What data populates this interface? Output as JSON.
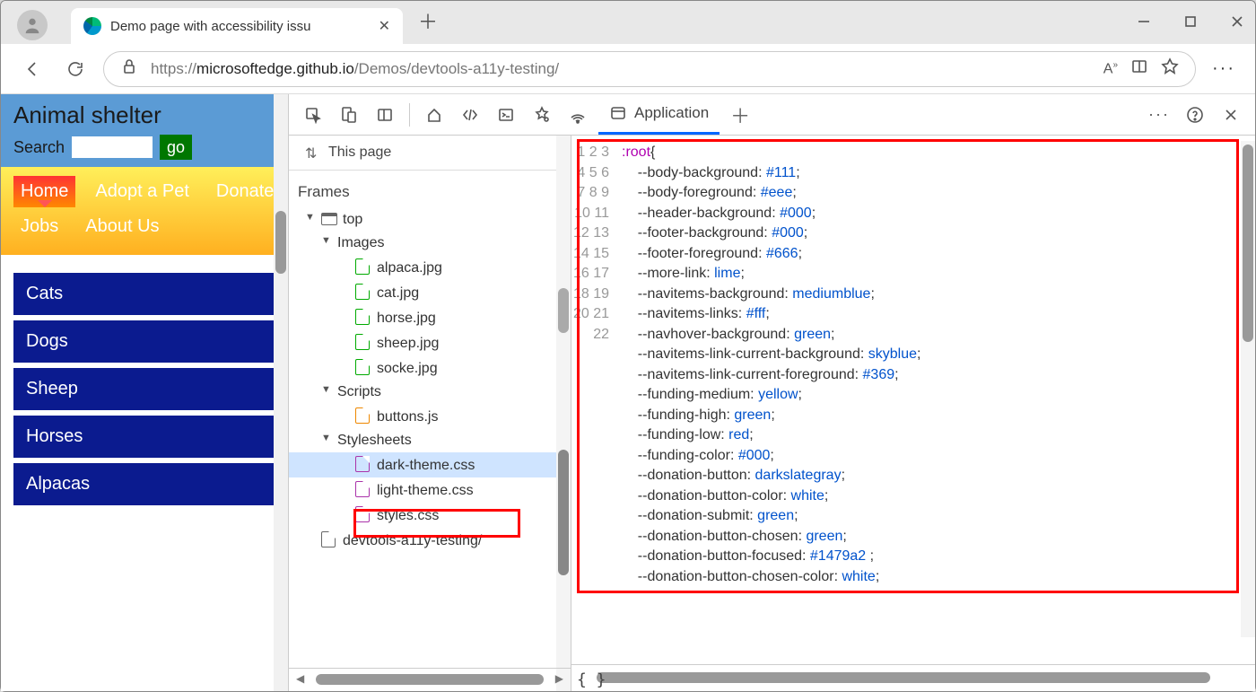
{
  "tab": {
    "title": "Demo page with accessibility issu"
  },
  "url": {
    "scheme": "https://",
    "host": "microsoftedge.github.io",
    "path": "/Demos/devtools-a11y-testing/"
  },
  "page": {
    "title": "Animal shelter",
    "searchLabel": "Search",
    "goLabel": "go",
    "nav": [
      "Home",
      "Adopt a Pet",
      "Donate",
      "Jobs",
      "About Us"
    ],
    "cats": [
      "Cats",
      "Dogs",
      "Sheep",
      "Horses",
      "Alpacas"
    ]
  },
  "devtools": {
    "appTab": "Application",
    "thisPage": "This page",
    "framesLabel": "Frames",
    "tree": {
      "top": "top",
      "images": {
        "label": "Images",
        "items": [
          "alpaca.jpg",
          "cat.jpg",
          "horse.jpg",
          "sheep.jpg",
          "socke.jpg"
        ]
      },
      "scripts": {
        "label": "Scripts",
        "items": [
          "buttons.js"
        ]
      },
      "stylesheets": {
        "label": "Stylesheets",
        "items": [
          "dark-theme.css",
          "light-theme.css",
          "styles.css"
        ]
      },
      "last": "devtools-a11y-testing/"
    }
  },
  "code": {
    "lines": [
      {
        "t": ":root",
        "v": "{"
      },
      {
        "t": "    --body-background: ",
        "v": "#111",
        "e": ";"
      },
      {
        "t": "    --body-foreground: ",
        "v": "#eee",
        "e": ";"
      },
      {
        "t": "    --header-background: ",
        "v": "#000",
        "e": ";"
      },
      {
        "t": "    --footer-background: ",
        "v": "#000",
        "e": ";"
      },
      {
        "t": "    --footer-foreground: ",
        "v": "#666",
        "e": ";"
      },
      {
        "t": "    --more-link: ",
        "v": "lime",
        "e": ";"
      },
      {
        "t": "    --navitems-background: ",
        "v": "mediumblue",
        "e": ";"
      },
      {
        "t": "    --navitems-links: ",
        "v": "#fff",
        "e": ";"
      },
      {
        "t": "    --navhover-background: ",
        "v": "green",
        "e": ";"
      },
      {
        "t": "    --navitems-link-current-background: ",
        "v": "skyblue",
        "e": ";"
      },
      {
        "t": "    --navitems-link-current-foreground: ",
        "v": "#369",
        "e": ";"
      },
      {
        "t": "    --funding-medium: ",
        "v": "yellow",
        "e": ";"
      },
      {
        "t": "    --funding-high: ",
        "v": "green",
        "e": ";"
      },
      {
        "t": "    --funding-low: ",
        "v": "red",
        "e": ";"
      },
      {
        "t": "    --funding-color: ",
        "v": "#000",
        "e": ";"
      },
      {
        "t": "    --donation-button: ",
        "v": "darkslategray",
        "e": ";"
      },
      {
        "t": "    --donation-button-color: ",
        "v": "white",
        "e": ";"
      },
      {
        "t": "    --donation-submit: ",
        "v": "green",
        "e": ";"
      },
      {
        "t": "    --donation-button-chosen: ",
        "v": "green",
        "e": ";"
      },
      {
        "t": "    --donation-button-focused: ",
        "v": "#1479a2 ",
        "e": ";"
      },
      {
        "t": "    --donation-button-chosen-color: ",
        "v": "white",
        "e": ";"
      }
    ]
  }
}
